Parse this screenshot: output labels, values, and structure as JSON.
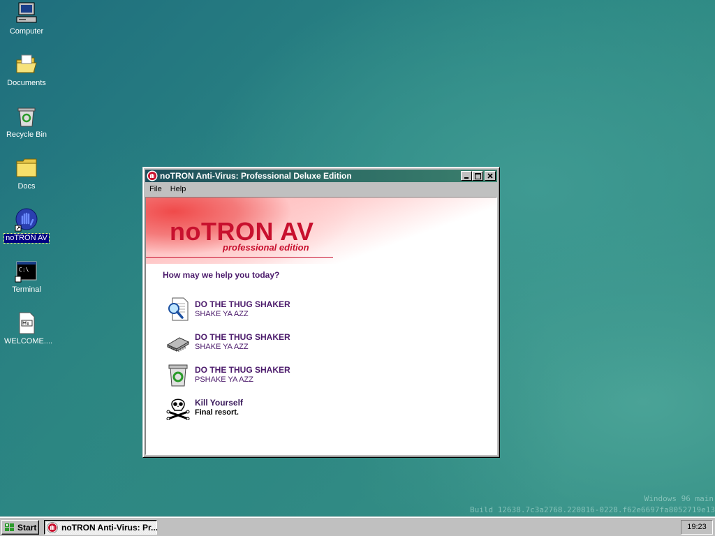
{
  "desktop": {
    "icons": [
      {
        "label": "Computer",
        "icon": "computer-icon"
      },
      {
        "label": "Documents",
        "icon": "folder-open-icon"
      },
      {
        "label": "Recycle Bin",
        "icon": "recycle-bin-icon"
      },
      {
        "label": "Docs",
        "icon": "folder-icon"
      },
      {
        "label": "noTRON AV",
        "icon": "notron-shield-icon",
        "selected": true
      },
      {
        "label": "Terminal",
        "icon": "terminal-icon"
      },
      {
        "label": "WELCOME....",
        "icon": "markdown-file-icon"
      }
    ],
    "watermark": {
      "line1": "Windows 96 main",
      "line2": "Build 12638.7c3a2768.220816-0228.f62e6697fa8052719e13"
    }
  },
  "window": {
    "title": "noTRON Anti-Virus: Professional Deluxe Edition",
    "menu": [
      "File",
      "Help"
    ],
    "brand": {
      "name": "noTRON AV",
      "edition": "professional edition"
    },
    "prompt": "How may we help you today?",
    "actions": [
      {
        "title": "DO THE THUG SHAKER",
        "subtitle": "SHAKE YA AZZ",
        "icon": "scan-magnifier-icon"
      },
      {
        "title": "DO THE THUG SHAKER",
        "subtitle": "SHAKE YA AZZ",
        "icon": "memory-chip-icon"
      },
      {
        "title": "DO THE THUG SHAKER",
        "subtitle": "PSHAKE YA AZZ",
        "icon": "recycle-bin-icon"
      },
      {
        "title": "Kill Yourself",
        "subtitle": "Final resort.",
        "icon": "skull-crossbones-icon"
      }
    ],
    "colors": {
      "brand_red": "#c8102e",
      "action_text": "#4b1a6b"
    }
  },
  "taskbar": {
    "start_label": "Start",
    "task_label": "noTRON Anti-Virus: Pr...",
    "clock": "19:23"
  }
}
